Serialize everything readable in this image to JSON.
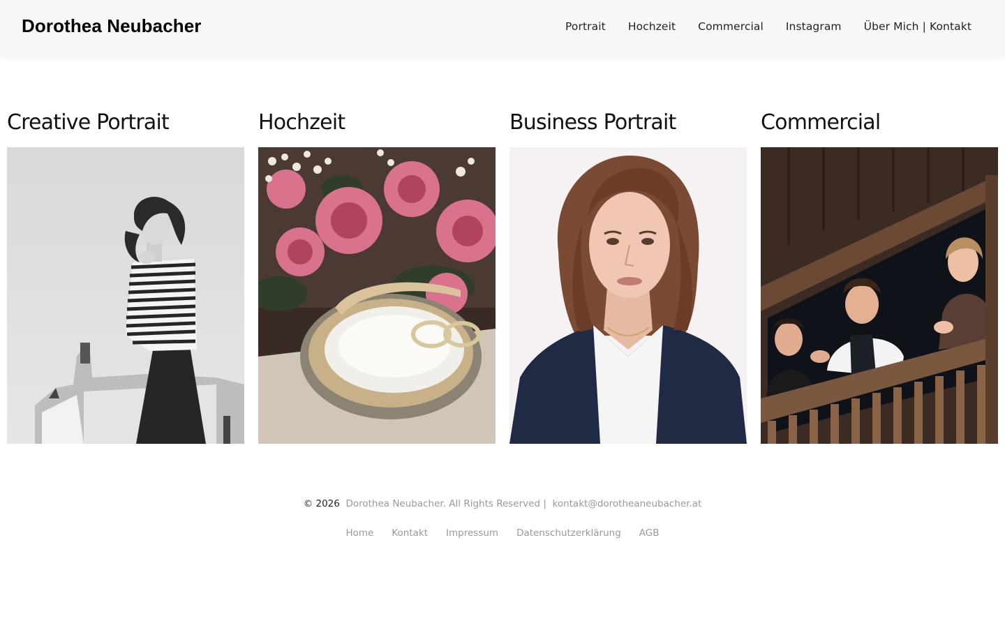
{
  "site": {
    "brand": "Dorothea Neubacher"
  },
  "nav": {
    "items": [
      {
        "label": "Portrait"
      },
      {
        "label": "Hochzeit"
      },
      {
        "label": "Commercial"
      },
      {
        "label": "Instagram"
      },
      {
        "label": "Über Mich | Kontakt"
      }
    ]
  },
  "gallery": {
    "cards": [
      {
        "title": "Creative Portrait",
        "image": "portrait-bw-woman-photo"
      },
      {
        "title": "Hochzeit",
        "image": "wedding-rings-flowers-photo"
      },
      {
        "title": "Business Portrait",
        "image": "business-woman-portrait-photo"
      },
      {
        "title": "Commercial",
        "image": "group-on-wooden-balcony-photo"
      }
    ]
  },
  "footer": {
    "year": "© 2026",
    "rights": "Dorothea Neubacher. All Rights Reserved |",
    "email": "kontakt@dorotheaneubacher.at",
    "links": [
      {
        "label": "Home"
      },
      {
        "label": "Kontakt"
      },
      {
        "label": "Impressum"
      },
      {
        "label": "Datenschutzerklärung"
      },
      {
        "label": "AGB"
      }
    ]
  }
}
